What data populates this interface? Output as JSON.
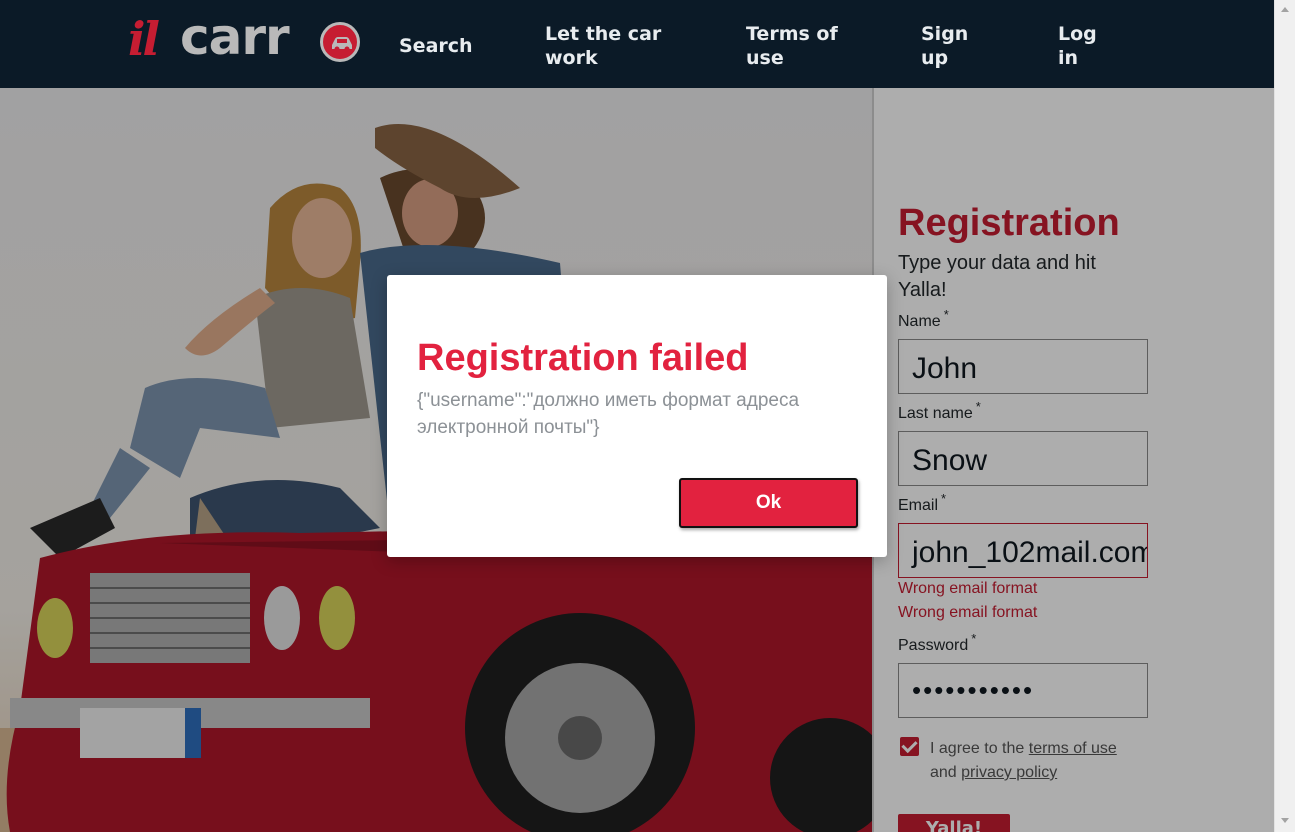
{
  "header": {
    "logo": "ilcarro",
    "logo_il": "il",
    "logo_carr": "carr",
    "nav": {
      "search": "Search",
      "let_car_work": "Let the car work",
      "terms": "Terms of use",
      "signup": "Sign up",
      "login": "Log in"
    }
  },
  "registration": {
    "title": "Registration",
    "subtitle": "Type your data and hit Yalla!",
    "required_mark": "*",
    "name_label": "Name",
    "name_value": "John",
    "lastname_label": "Last name",
    "lastname_value": "Snow",
    "email_label": "Email",
    "email_value": "john_102mail.com",
    "email_error_1": "Wrong email format",
    "email_error_2": "Wrong email format",
    "password_label": "Password",
    "password_value": "•••••••••••",
    "agree_prefix": "I agree to the",
    "terms_link": "terms of use",
    "agree_and": "and",
    "privacy_link": "privacy policy",
    "agreed": true,
    "submit": "Yalla!"
  },
  "dialog": {
    "title": "Registration failed",
    "message": "{\"username\":\"должно иметь формат адреса электронной почты\"}",
    "ok": "Ok"
  },
  "colors": {
    "header_bg": "#0b1a27",
    "brand_red": "#c61d32",
    "dialog_red": "#e2223f"
  }
}
